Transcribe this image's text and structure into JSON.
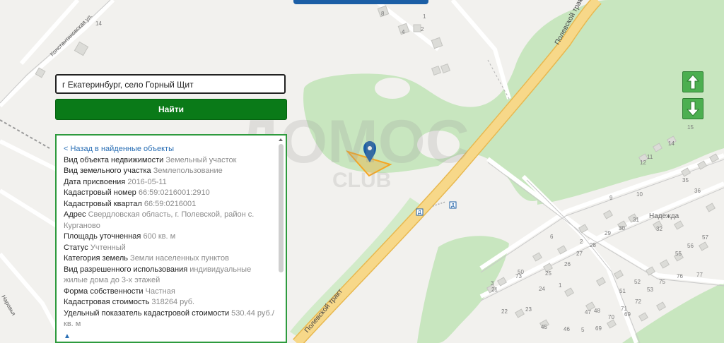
{
  "search": {
    "value": "г Екатеринбург, село Горный Щит",
    "button_label": "Найти"
  },
  "info": {
    "back_link": "< Назад в найденные объекты",
    "rows": [
      {
        "label": "Вид объекта недвижимости",
        "value": "Земельный участок"
      },
      {
        "label": "Вид земельного участка",
        "value": "Землепользование"
      },
      {
        "label": "Дата присвоения",
        "value": "2016-05-11"
      },
      {
        "label": "Кадастровый номер",
        "value": "66:59:0216001:2910"
      },
      {
        "label": "Кадастровый квартал",
        "value": "66:59:0216001"
      },
      {
        "label": "Адрес",
        "value": "Свердловская область, г. Полевской, район с. Курганово"
      },
      {
        "label": "Площадь уточненная",
        "value": "600 кв. м"
      },
      {
        "label": "Статус",
        "value": "Учтенный"
      },
      {
        "label": "Категория земель",
        "value": "Земли населенных пунктов"
      },
      {
        "label": "Вид разрешенного использования",
        "value": "индивидуальные жилые дома до 3-х этажей"
      },
      {
        "label": "Форма собственности",
        "value": "Частная"
      },
      {
        "label": "Кадастровая стоимость",
        "value": "318264 руб."
      },
      {
        "label": "Удельный показатель кадастровой стоимости",
        "value": "530.44 руб./ кв. м"
      }
    ],
    "up_symbol": "▲"
  },
  "map": {
    "roads": {
      "main_upper": "Полевской тракт",
      "main_lower": "Полевской тракт",
      "konst": "Константиновская ул.",
      "left_street": "Наровья"
    },
    "place": "Надежда",
    "watermark": {
      "main": "ДОМОС",
      "sub": "CLUB"
    },
    "house_numbers": [
      {
        "t": "8"
      },
      {
        "t": "4"
      },
      {
        "t": "2"
      },
      {
        "t": "1"
      },
      {
        "t": "14"
      },
      {
        "t": "15"
      },
      {
        "t": "14"
      },
      {
        "t": "12"
      },
      {
        "t": "11"
      },
      {
        "t": "10"
      },
      {
        "t": "9"
      },
      {
        "t": "6"
      },
      {
        "t": "2"
      },
      {
        "t": "29"
      },
      {
        "t": "30"
      },
      {
        "t": "31"
      },
      {
        "t": "32"
      },
      {
        "t": "35"
      },
      {
        "t": "36"
      },
      {
        "t": "56"
      },
      {
        "t": "57"
      },
      {
        "t": "55"
      },
      {
        "t": "77"
      },
      {
        "t": "76"
      },
      {
        "t": "75"
      },
      {
        "t": "52"
      },
      {
        "t": "51"
      },
      {
        "t": "53"
      },
      {
        "t": "25"
      },
      {
        "t": "26"
      },
      {
        "t": "27"
      },
      {
        "t": "28"
      },
      {
        "t": "24"
      },
      {
        "t": "23"
      },
      {
        "t": "22"
      },
      {
        "t": "21"
      },
      {
        "t": "45"
      },
      {
        "t": "46"
      },
      {
        "t": "47"
      },
      {
        "t": "48"
      },
      {
        "t": "69"
      },
      {
        "t": "70"
      },
      {
        "t": "71"
      },
      {
        "t": "72"
      },
      {
        "t": "73"
      },
      {
        "t": "50"
      },
      {
        "t": "3"
      },
      {
        "t": "1"
      },
      {
        "t": "5"
      },
      {
        "t": "69"
      }
    ]
  },
  "colors": {
    "accent_green": "#0a7a18",
    "panel_border": "#2e9b3e",
    "nav_green": "#4caf50",
    "road_yellow": "#f5d27a",
    "park_green": "#c8e6bf",
    "parcel_orange": "#f5a623",
    "pin_blue": "#1c5fa6"
  },
  "icons": {
    "up": "arrow-up-icon",
    "down": "arrow-down-icon",
    "pin": "map-pin-icon",
    "bus_stop": "bus-stop-icon"
  }
}
